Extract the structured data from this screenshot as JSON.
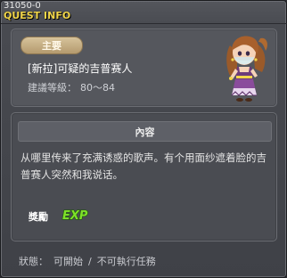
{
  "window": {
    "quest_id": "31050-0",
    "title": "QUEST INFO"
  },
  "quest": {
    "tag": "主要",
    "name": "[新拉]可疑的吉普赛人",
    "level_label": "建議等級：",
    "level_range": "80～84"
  },
  "content": {
    "header": "內容",
    "description": "从哪里传来了充满诱惑的歌声。有个用面纱遮着脸的吉普赛人突然和我说话。",
    "reward_label": "獎勵",
    "reward_icon": "exp-icon",
    "reward_text": "EXP"
  },
  "status": {
    "label": "狀態：",
    "value": "可開始",
    "separator": "/",
    "detail": "不可執行任務"
  },
  "colors": {
    "title": "#f2d64a",
    "tag_bg": "#c9b083",
    "exp_green": "#7ee02a"
  }
}
